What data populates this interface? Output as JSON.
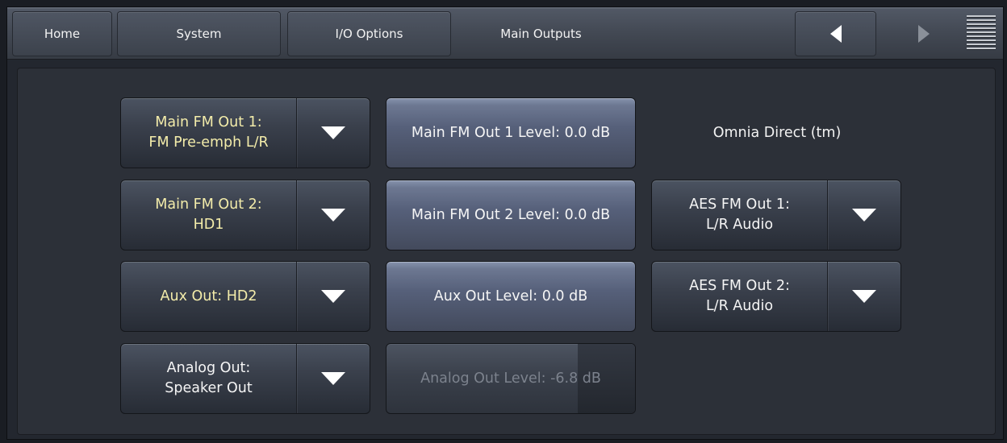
{
  "nav": {
    "home": "Home",
    "system": "System",
    "io_options": "I/O Options",
    "current": "Main Outputs"
  },
  "outputs": {
    "main_fm_out_1": "Main FM Out 1:\nFM Pre-emph L/R",
    "main_fm_out_2": "Main FM Out 2:\nHD1",
    "aux_out": "Aux Out: HD2",
    "analog_out": "Analog Out:\nSpeaker Out",
    "main_fm_out_1_level": "Main FM Out 1 Level: 0.0 dB",
    "main_fm_out_2_level": "Main FM Out 2 Level: 0.0 dB",
    "aux_out_level": "Aux Out Level: 0.0 dB",
    "analog_out_level": "Analog Out Level: -6.8 dB",
    "omnia_direct": "Omnia Direct (tm)",
    "aes_fm_out_1": "AES FM Out 1:\nL/R Audio",
    "aes_fm_out_2": "AES FM Out 2:\nL/R Audio"
  },
  "icons": {
    "back": "left-triangle-arrow",
    "forward": "right-triangle-arrow",
    "menu": "hamburger-lines",
    "dropdown": "down-triangle"
  },
  "colors": {
    "selected_text": "#f3ecaa",
    "disabled_text": "#7c828d"
  }
}
